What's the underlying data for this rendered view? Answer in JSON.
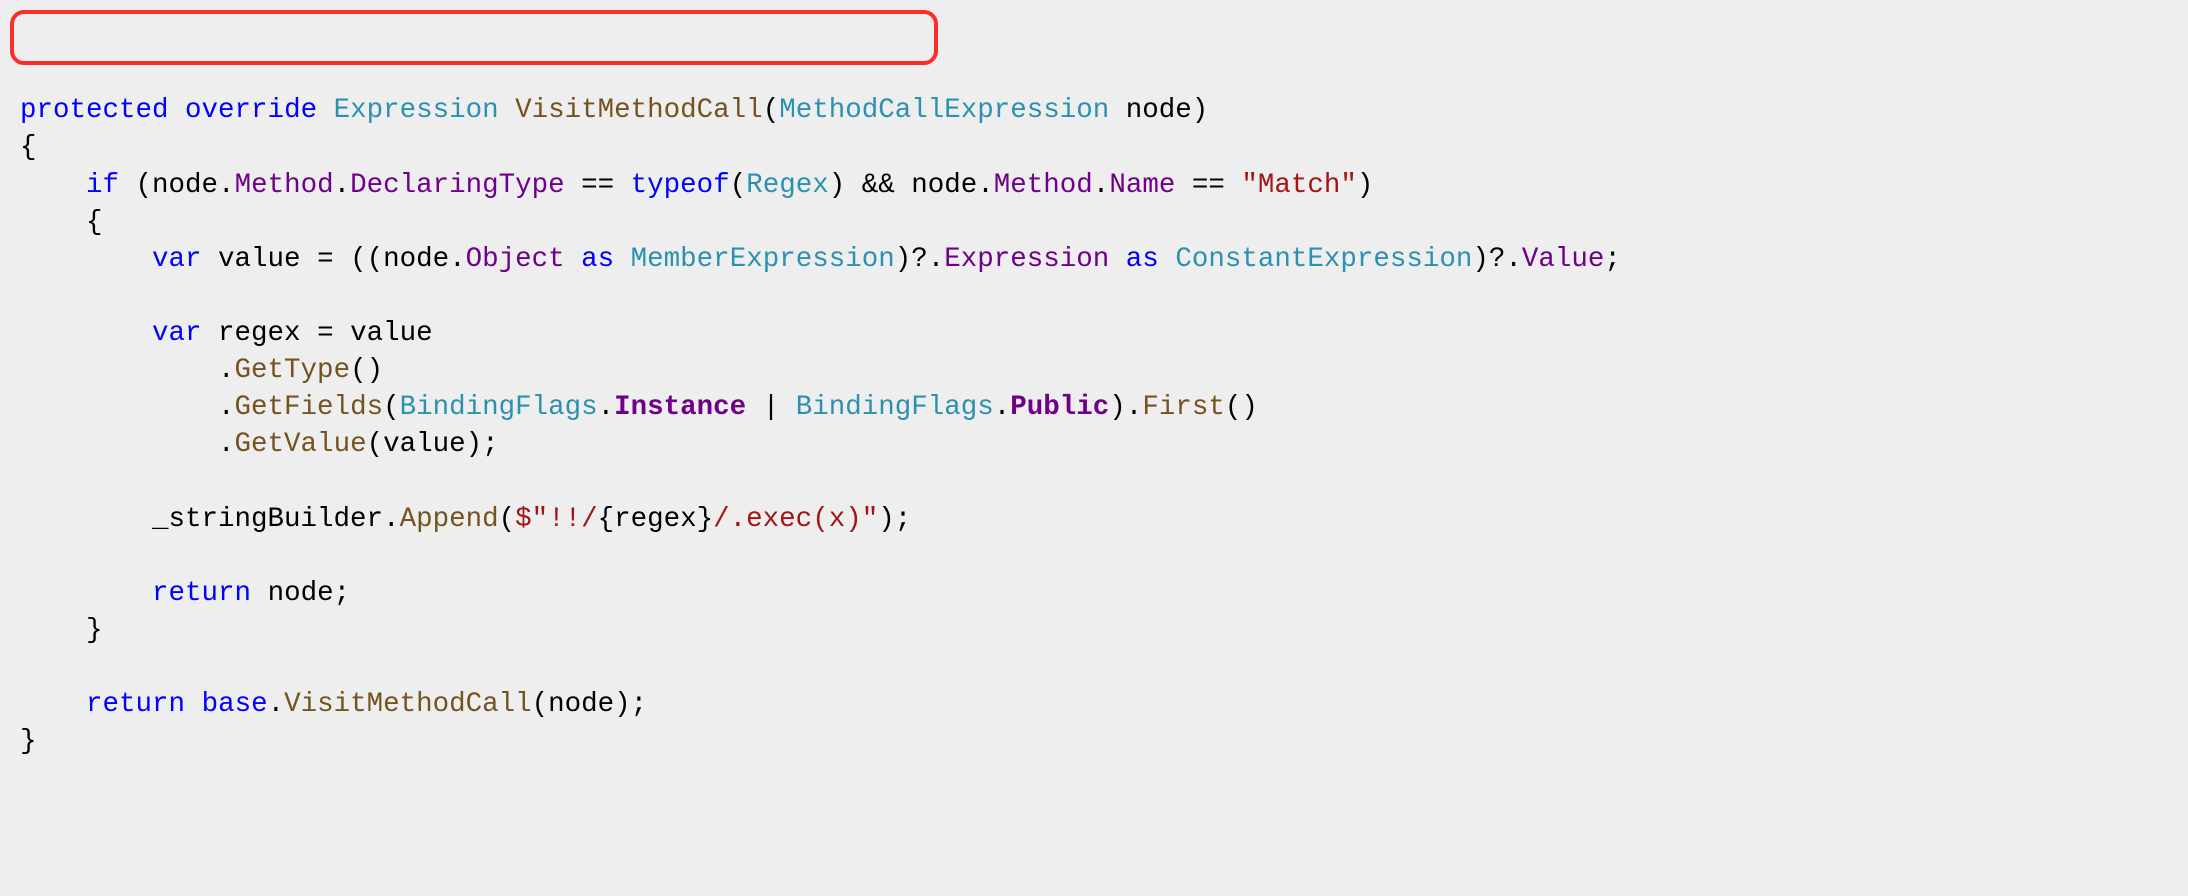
{
  "code": {
    "line01": {
      "kw_protected": "protected",
      "kw_override": "override",
      "type_expression": "Expression",
      "method_visit": "VisitMethodCall",
      "type_param": "MethodCallExpression",
      "param_name": "node",
      "paren_close": ")"
    },
    "line02": "{",
    "line03": {
      "indent": "    ",
      "kw_if": "if",
      "open": " (node.",
      "prop_method1": "Method",
      "dot1": ".",
      "prop_decl": "DeclaringType",
      "eq1": " == ",
      "kw_typeof": "typeof",
      "po": "(",
      "type_regex": "Regex",
      "pc": ") && node.",
      "prop_method2": "Method",
      "dot2": ".",
      "prop_name": "Name",
      "eq2": " == ",
      "str_match": "\"Match\"",
      "close": ")"
    },
    "line04": "    {",
    "line05": {
      "indent": "        ",
      "kw_var": "var",
      "rest1": " value = ((node.",
      "prop_object": "Object",
      "as1": " ",
      "kw_as1": "as",
      "sp1": " ",
      "type_member": "MemberExpression",
      "q1": ")?.",
      "prop_expression": "Expression",
      "sp2": " ",
      "kw_as2": "as",
      "sp3": " ",
      "type_const": "ConstantExpression",
      "q2": ")?.",
      "prop_value": "Value",
      "semi": ";"
    },
    "line06": "",
    "line07": {
      "indent": "        ",
      "kw_var": "var",
      "txt": " regex = value"
    },
    "line08": {
      "indent": "            .",
      "method": "GetType",
      "rest": "()"
    },
    "line09": {
      "indent": "            .",
      "method": "GetFields",
      "open": "(",
      "type1": "BindingFlags",
      "dot1": ".",
      "prop1": "Instance",
      "pipe": " | ",
      "type2": "BindingFlags",
      "dot2": ".",
      "prop2": "Public",
      "close": ").",
      "method2": "First",
      "rest": "()"
    },
    "line10": {
      "indent": "            .",
      "method": "GetValue",
      "rest": "(value);"
    },
    "line11": "",
    "line12": {
      "indent": "        _stringBuilder.",
      "method": "Append",
      "open": "(",
      "str1": "$\"!!/",
      "interp_open": "{",
      "interp_var": "regex",
      "interp_close": "}",
      "str2": "/.exec(x)\"",
      "close": ");"
    },
    "line13": "",
    "line14": {
      "indent": "        ",
      "kw_return": "return",
      "rest": " node;"
    },
    "line15": "    }",
    "line16": "",
    "line17": {
      "indent": "    ",
      "kw_return": "return",
      "sp": " ",
      "kw_base": "base",
      "dot": ".",
      "method": "VisitMethodCall",
      "rest": "(node);"
    },
    "line18": "}"
  }
}
